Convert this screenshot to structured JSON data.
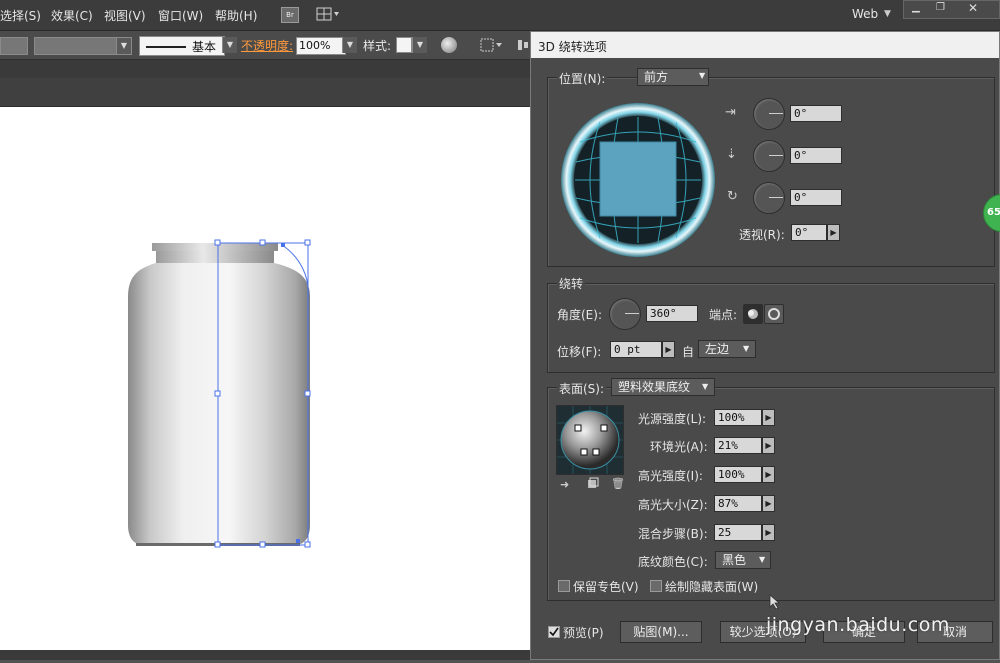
{
  "menubar": {
    "items": [
      "选择(S)",
      "效果(C)",
      "视图(V)",
      "窗口(W)",
      "帮助(H)"
    ],
    "bridge_label": "Br",
    "workspace": "Web"
  },
  "control_bar": {
    "stroke_label": "基本",
    "opacity_label": "不透明度:",
    "opacity_value": "100%",
    "style_label": "样式:"
  },
  "dialog": {
    "title": "3D 绕转选项",
    "position": {
      "label": "位置(N):",
      "value": "前方",
      "rot_x": "0°",
      "rot_y": "0°",
      "rot_z": "0°",
      "perspective_label": "透视(R):",
      "perspective_value": "0°"
    },
    "revolve": {
      "header": "绕转",
      "angle_label": "角度(E):",
      "angle_value": "360°",
      "cap_label": "端点:",
      "offset_label": "位移(F):",
      "offset_value": "0 pt",
      "from_label": "自",
      "from_value": "左边"
    },
    "surface": {
      "label": "表面(S):",
      "value": "塑料效果底纹",
      "light_intensity_label": "光源强度(L):",
      "light_intensity_value": "100%",
      "ambient_label": "环境光(A):",
      "ambient_value": "21%",
      "highlight_intensity_label": "高光强度(I):",
      "highlight_intensity_value": "100%",
      "highlight_size_label": "高光大小(Z):",
      "highlight_size_value": "87%",
      "blend_steps_label": "混合步骤(B):",
      "blend_steps_value": "25",
      "shade_color_label": "底纹颜色(C):",
      "shade_color_value": "黑色",
      "preserve_spot_label": "保留专色(V)",
      "draw_hidden_label": "绘制隐藏表面(W)"
    },
    "footer": {
      "preview_label": "预览(P)",
      "map_button": "贴图(M)...",
      "fewer_options_button": "较少选项(O)",
      "ok_button": "确定",
      "cancel_button": "取消"
    }
  },
  "watermark": "jingyan.baidu.com",
  "badge": "65",
  "colors": {
    "preview_square": "#5ba3bf",
    "ring_glow": "#7fd3e6",
    "badge_green": "#3fb34f",
    "opacity_orange": "#ff9a3c"
  }
}
